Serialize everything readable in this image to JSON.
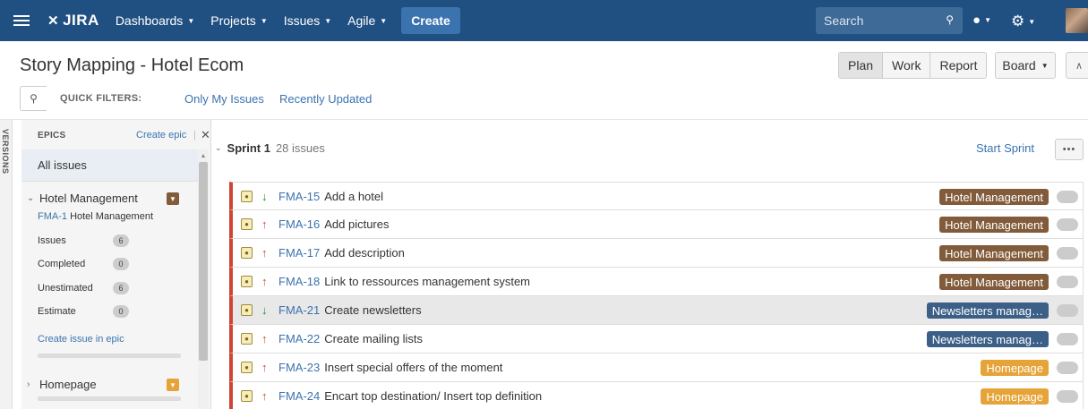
{
  "nav": {
    "logo": "JIRA",
    "items": [
      "Dashboards",
      "Projects",
      "Issues",
      "Agile"
    ],
    "create_label": "Create",
    "search_placeholder": "Search"
  },
  "header": {
    "title": "Story Mapping - Hotel Ecom",
    "modes": [
      "Plan",
      "Work",
      "Report"
    ],
    "active_mode": "Plan",
    "board_label": "Board"
  },
  "quick_filters": {
    "label": "QUICK FILTERS:",
    "items": [
      "Only My Issues",
      "Recently Updated"
    ]
  },
  "versions_label": "VERSIONS",
  "epics_panel": {
    "heading": "EPICS",
    "create_label": "Create epic",
    "separator": "|",
    "all_issues_label": "All issues",
    "epics": [
      {
        "name": "Hotel Management",
        "key": "FMA-1",
        "key_title": "Hotel Management",
        "color": "#815b3a",
        "expanded": true,
        "stats": [
          {
            "label": "Issues",
            "value": "6"
          },
          {
            "label": "Completed",
            "value": "0"
          },
          {
            "label": "Unestimated",
            "value": "6"
          },
          {
            "label": "Estimate",
            "value": "0"
          }
        ],
        "create_issue_label": "Create issue in epic"
      },
      {
        "name": "Homepage",
        "color": "#e5a338",
        "expanded": false
      }
    ]
  },
  "sprint": {
    "name": "Sprint 1",
    "count_label": "28 issues",
    "start_label": "Start Sprint",
    "more_label": "•••",
    "issues": [
      {
        "key": "FMA-15",
        "summary": "Add a hotel",
        "priority": "down",
        "epic": "Hotel Management",
        "epic_color": "#815b3a"
      },
      {
        "key": "FMA-16",
        "summary": "Add pictures",
        "priority": "up",
        "epic": "Hotel Management",
        "epic_color": "#815b3a"
      },
      {
        "key": "FMA-17",
        "summary": "Add description",
        "priority": "up",
        "epic": "Hotel Management",
        "epic_color": "#815b3a"
      },
      {
        "key": "FMA-18",
        "summary": "Link to ressources management system",
        "priority": "up",
        "epic": "Hotel Management",
        "epic_color": "#815b3a"
      },
      {
        "key": "FMA-21",
        "summary": "Create newsletters",
        "priority": "down",
        "epic": "Newsletters manag…",
        "epic_color": "#3b5f87",
        "selected": true
      },
      {
        "key": "FMA-22",
        "summary": "Create mailing lists",
        "priority": "up",
        "epic": "Newsletters manag…",
        "epic_color": "#3b5f87"
      },
      {
        "key": "FMA-23",
        "summary": "Insert special offers of the moment",
        "priority": "up",
        "epic": "Homepage",
        "epic_color": "#e5a338"
      },
      {
        "key": "FMA-24",
        "summary": "Encart top destination/ Insert top definition",
        "priority": "up",
        "epic": "Homepage",
        "epic_color": "#e5a338"
      }
    ]
  }
}
